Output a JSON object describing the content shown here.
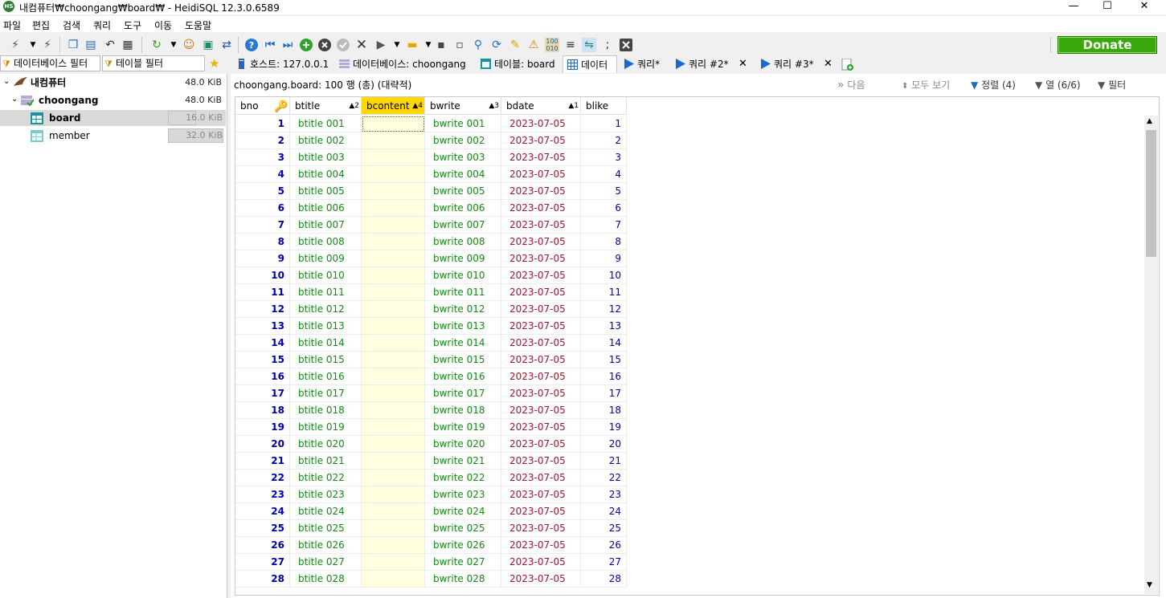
{
  "window": {
    "title": "내컴퓨터₩choongang₩board₩ - HeidiSQL 12.3.0.6589",
    "app_badge": "HS",
    "minimize": "—",
    "maximize": "☐",
    "close": "✕"
  },
  "menu": [
    "파일",
    "편집",
    "검색",
    "쿼리",
    "도구",
    "이동",
    "도움말"
  ],
  "toolbar": {
    "donate_label": "Donate"
  },
  "filters": {
    "database_filter": "데이터베이스 필터",
    "table_filter": "테이블 필터"
  },
  "tabs": [
    {
      "label": "호스트: 127.0.0.1",
      "icon": "host-icon"
    },
    {
      "label": "데이터베이스: choongang",
      "icon": "database-icon"
    },
    {
      "label": "테이블: board",
      "icon": "table-icon"
    },
    {
      "label": "데이터",
      "icon": "grid-icon",
      "active": true
    },
    {
      "label": "쿼리*",
      "icon": "play-icon"
    },
    {
      "label": "쿼리 #2*",
      "icon": "play-icon",
      "close": "✕"
    },
    {
      "label": "쿼리 #3*",
      "icon": "play-icon",
      "close": "✕"
    }
  ],
  "tree": {
    "root": {
      "label": "내컴퓨터",
      "size": "48.0 KiB"
    },
    "database": {
      "label": "choongang",
      "size": "48.0 KiB"
    },
    "tables": [
      {
        "label": "board",
        "size": "16.0 KiB",
        "fill": 0.5,
        "selected": true
      },
      {
        "label": "member",
        "size": "32.0 KiB",
        "fill": 1.0,
        "selected": false
      }
    ]
  },
  "datainfo": {
    "summary": "choongang.board: 100 행 (총) (대략적)",
    "next": "다음",
    "show_all": "모두 보기",
    "sort": "정렬 (4)",
    "columns_ctrl": "열 (6/6)",
    "filter": "필터"
  },
  "grid": {
    "columns": [
      {
        "name": "bno",
        "sort": ""
      },
      {
        "name": "btitle",
        "sort": "▲2"
      },
      {
        "name": "bcontent",
        "sort": "▲4"
      },
      {
        "name": "bwrite",
        "sort": "▲3"
      },
      {
        "name": "bdate",
        "sort": "▲1"
      },
      {
        "name": "blike",
        "sort": ""
      }
    ],
    "rows": [
      [
        "1",
        "btitle 001",
        "",
        "bwrite 001",
        "2023-07-05",
        "1"
      ],
      [
        "2",
        "btitle 002",
        "",
        "bwrite 002",
        "2023-07-05",
        "2"
      ],
      [
        "3",
        "btitle 003",
        "",
        "bwrite 003",
        "2023-07-05",
        "3"
      ],
      [
        "4",
        "btitle 004",
        "",
        "bwrite 004",
        "2023-07-05",
        "4"
      ],
      [
        "5",
        "btitle 005",
        "",
        "bwrite 005",
        "2023-07-05",
        "5"
      ],
      [
        "6",
        "btitle 006",
        "",
        "bwrite 006",
        "2023-07-05",
        "6"
      ],
      [
        "7",
        "btitle 007",
        "",
        "bwrite 007",
        "2023-07-05",
        "7"
      ],
      [
        "8",
        "btitle 008",
        "",
        "bwrite 008",
        "2023-07-05",
        "8"
      ],
      [
        "9",
        "btitle 009",
        "",
        "bwrite 009",
        "2023-07-05",
        "9"
      ],
      [
        "10",
        "btitle 010",
        "",
        "bwrite 010",
        "2023-07-05",
        "10"
      ],
      [
        "11",
        "btitle 011",
        "",
        "bwrite 011",
        "2023-07-05",
        "11"
      ],
      [
        "12",
        "btitle 012",
        "",
        "bwrite 012",
        "2023-07-05",
        "12"
      ],
      [
        "13",
        "btitle 013",
        "",
        "bwrite 013",
        "2023-07-05",
        "13"
      ],
      [
        "14",
        "btitle 014",
        "",
        "bwrite 014",
        "2023-07-05",
        "14"
      ],
      [
        "15",
        "btitle 015",
        "",
        "bwrite 015",
        "2023-07-05",
        "15"
      ],
      [
        "16",
        "btitle 016",
        "",
        "bwrite 016",
        "2023-07-05",
        "16"
      ],
      [
        "17",
        "btitle 017",
        "",
        "bwrite 017",
        "2023-07-05",
        "17"
      ],
      [
        "18",
        "btitle 018",
        "",
        "bwrite 018",
        "2023-07-05",
        "18"
      ],
      [
        "19",
        "btitle 019",
        "",
        "bwrite 019",
        "2023-07-05",
        "19"
      ],
      [
        "20",
        "btitle 020",
        "",
        "bwrite 020",
        "2023-07-05",
        "20"
      ],
      [
        "21",
        "btitle 021",
        "",
        "bwrite 021",
        "2023-07-05",
        "21"
      ],
      [
        "22",
        "btitle 022",
        "",
        "bwrite 022",
        "2023-07-05",
        "22"
      ],
      [
        "23",
        "btitle 023",
        "",
        "bwrite 023",
        "2023-07-05",
        "23"
      ],
      [
        "24",
        "btitle 024",
        "",
        "bwrite 024",
        "2023-07-05",
        "24"
      ],
      [
        "25",
        "btitle 025",
        "",
        "bwrite 025",
        "2023-07-05",
        "25"
      ],
      [
        "26",
        "btitle 026",
        "",
        "bwrite 026",
        "2023-07-05",
        "26"
      ],
      [
        "27",
        "btitle 027",
        "",
        "bwrite 027",
        "2023-07-05",
        "27"
      ],
      [
        "28",
        "btitle 028",
        "",
        "bwrite 028",
        "2023-07-05",
        "28"
      ]
    ]
  },
  "colors": {
    "accent": "#0066cc",
    "number": "#0000a8",
    "text": "#138a13",
    "date": "#a0172c",
    "sorted_header": "#ffd800",
    "sorted_column": "#ffffe0",
    "donate": "#3aa80c"
  }
}
